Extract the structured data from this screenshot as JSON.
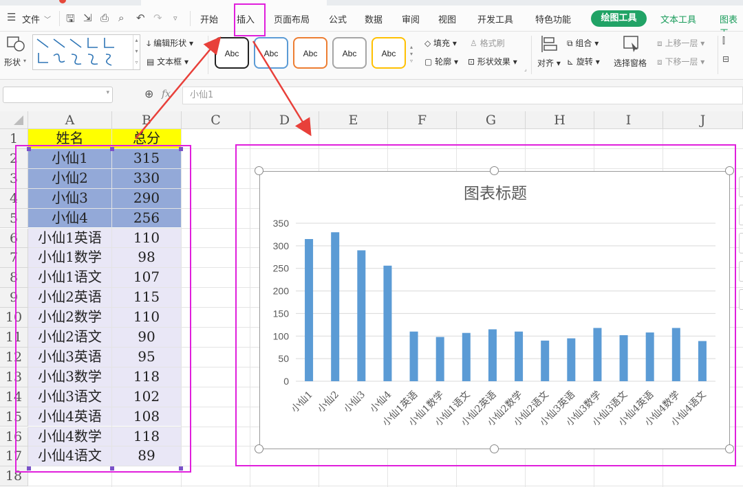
{
  "menu": {
    "file": "文件",
    "tabs": [
      "开始",
      "插入",
      "页面布局",
      "公式",
      "数据",
      "审阅",
      "视图",
      "开发工具",
      "特色功能"
    ],
    "drawing_tools": "绘图工具",
    "text_tools": "文本工具",
    "chart_tools_partial": "图表工"
  },
  "ribbon": {
    "shape": "形状",
    "edit_shape": "编辑形状",
    "text_box": "文本框",
    "abc": "Abc",
    "fill": "填充",
    "outline": "轮廓",
    "format_painter": "格式刷",
    "shape_effect": "形状效果",
    "align": "对齐",
    "group": "组合",
    "rotate": "旋转",
    "selection_pane": "选择窗格",
    "bring_forward": "上移一层",
    "send_backward": "下移一层"
  },
  "formula_bar": {
    "fx": "fx",
    "value": "小仙1"
  },
  "columns": [
    "A",
    "B",
    "C",
    "D",
    "E",
    "F",
    "G",
    "H",
    "I",
    "J"
  ],
  "rows": [
    "1",
    "2",
    "3",
    "4",
    "5",
    "6",
    "7",
    "8",
    "9",
    "10",
    "11",
    "12",
    "13",
    "14",
    "15",
    "16",
    "17",
    "18"
  ],
  "sheet": {
    "header": [
      "姓名",
      "总分"
    ],
    "names": [
      "小仙1",
      "小仙2",
      "小仙3",
      "小仙4",
      "小仙1英语",
      "小仙1数学",
      "小仙1语文",
      "小仙2英语",
      "小仙2数学",
      "小仙2语文",
      "小仙3英语",
      "小仙3数学",
      "小仙3语文",
      "小仙4英语",
      "小仙4数学",
      "小仙4语文"
    ],
    "scores": [
      "315",
      "330",
      "290",
      "256",
      "110",
      "98",
      "107",
      "115",
      "110",
      "90",
      "95",
      "118",
      "102",
      "108",
      "118",
      "89"
    ]
  },
  "colors": {
    "header_fill": "#ffff00",
    "selected_fill": "#93a9d8",
    "range_fill": "#e9e7f6",
    "bar": "#5b9bd5",
    "annotation": "#e01edc",
    "arrow": "#e8403a"
  },
  "chart_data": {
    "type": "bar",
    "title": "图表标题",
    "categories": [
      "小仙1",
      "小仙2",
      "小仙3",
      "小仙4",
      "小仙1英语",
      "小仙1数学",
      "小仙1语文",
      "小仙2英语",
      "小仙2数学",
      "小仙2语文",
      "小仙3英语",
      "小仙3数学",
      "小仙3语文",
      "小仙4英语",
      "小仙4数学",
      "小仙4语文"
    ],
    "values": [
      315,
      330,
      290,
      256,
      110,
      98,
      107,
      115,
      110,
      90,
      95,
      118,
      102,
      108,
      118,
      89
    ],
    "ylim": [
      0,
      350
    ],
    "yticks": [
      0,
      50,
      100,
      150,
      200,
      250,
      300,
      350
    ],
    "grid": true,
    "legend": "none"
  }
}
